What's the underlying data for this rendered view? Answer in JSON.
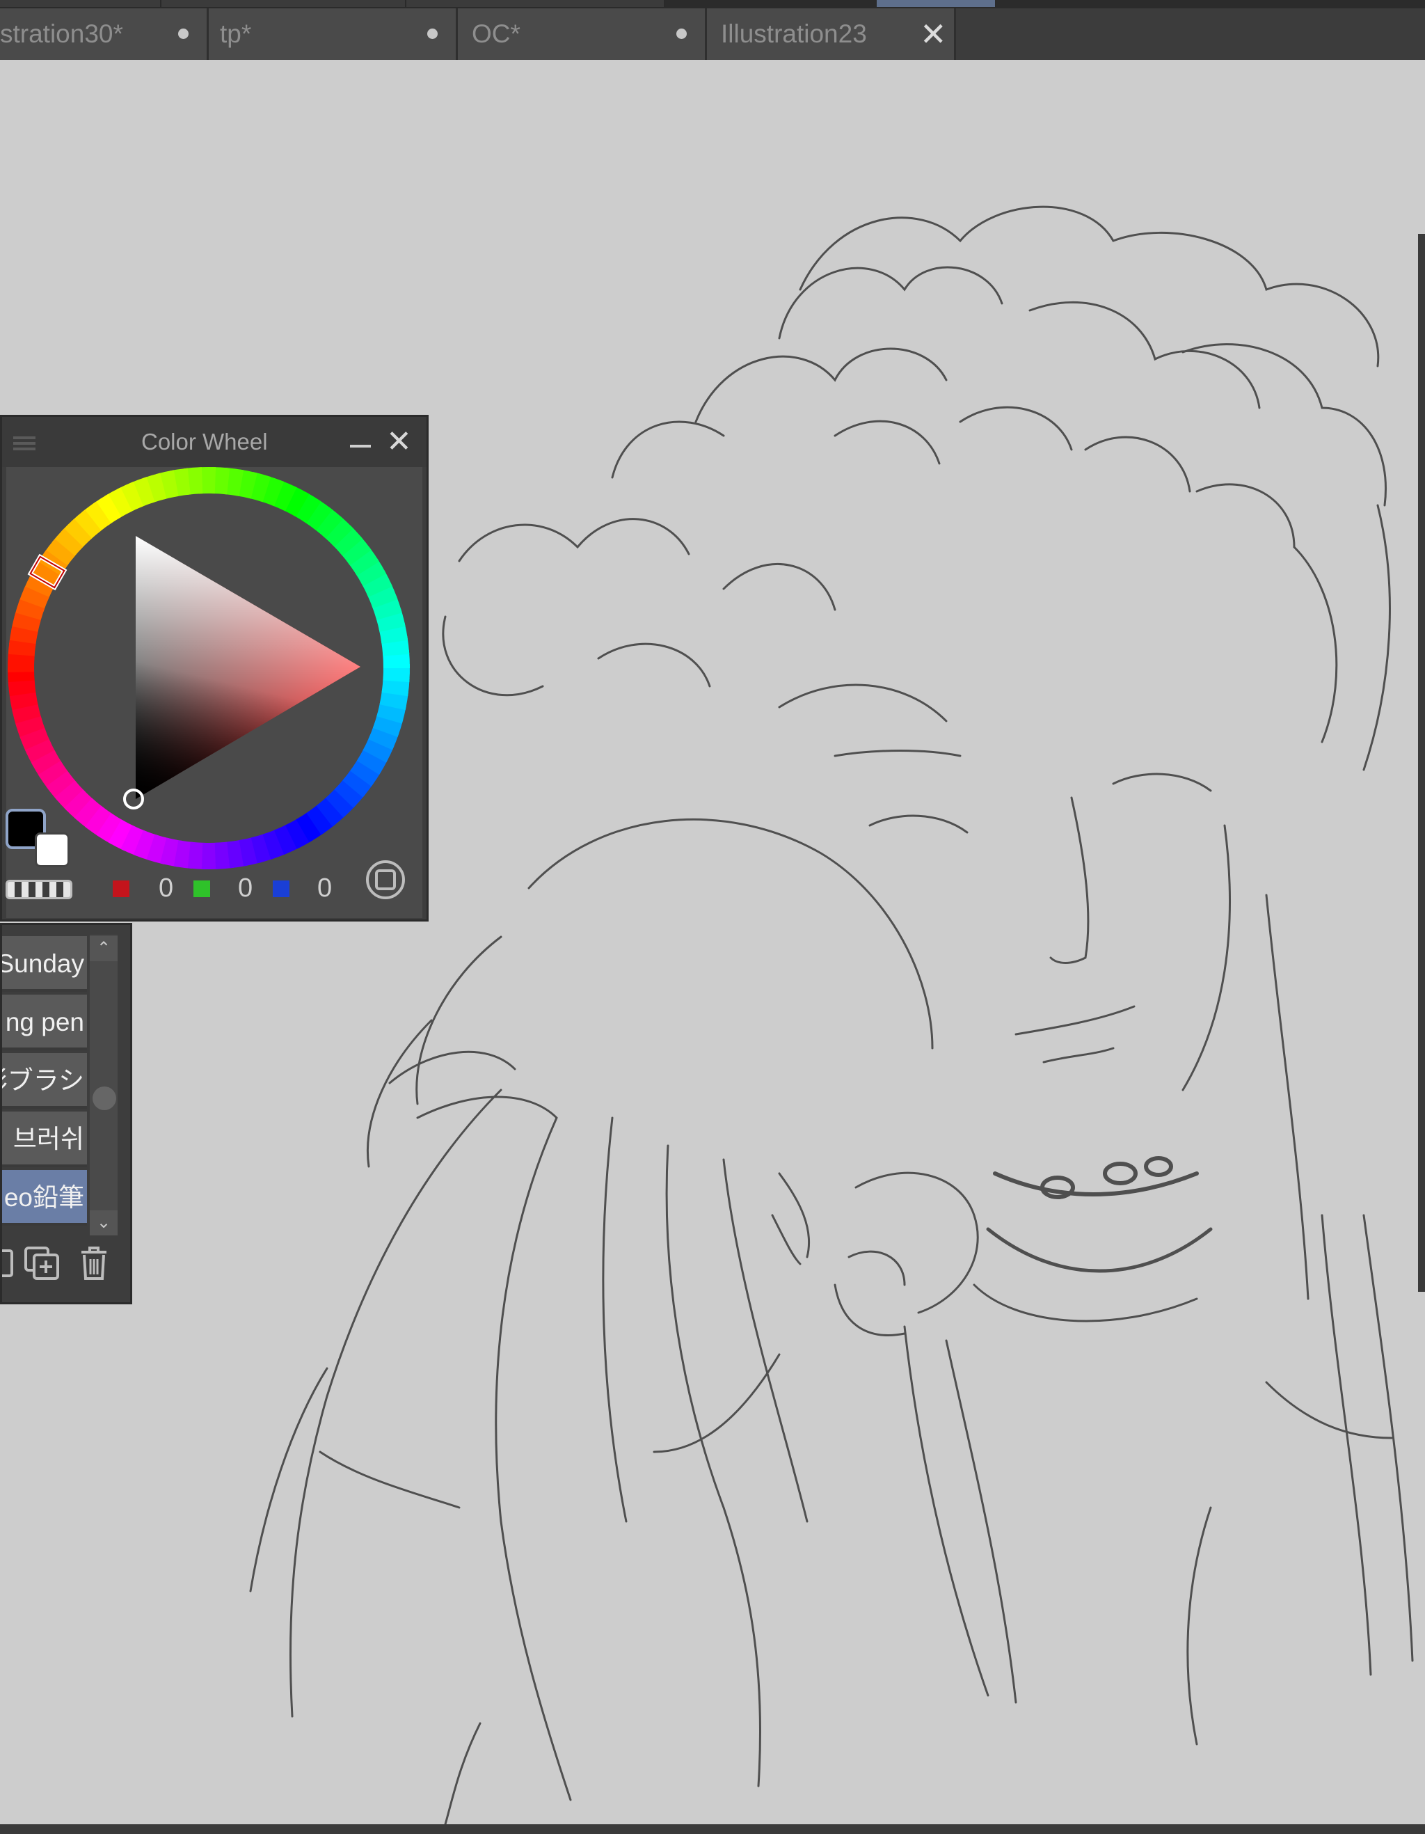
{
  "tabs": [
    {
      "label": "stration30*",
      "modified": true
    },
    {
      "label": "tp*",
      "modified": true
    },
    {
      "label": "OC*",
      "modified": true
    },
    {
      "label": "Illustration23",
      "modified": false,
      "active": true
    }
  ],
  "color_wheel": {
    "title": "Color Wheel",
    "main_color": "#000000",
    "sub_color": "#ffffff",
    "rgb": {
      "r": "0",
      "g": "0",
      "b": "0"
    }
  },
  "brush_list": {
    "items": [
      "Sunday",
      "ng pen",
      "彩ブラシ",
      "ㅎ 브러쉬",
      "eo鉛筆"
    ],
    "selected_index": 4
  },
  "colors": {
    "canvas_bg": "#cdcdcd",
    "panel_bg": "#4a4a4a",
    "selection_blue": "#6a7ea6"
  }
}
